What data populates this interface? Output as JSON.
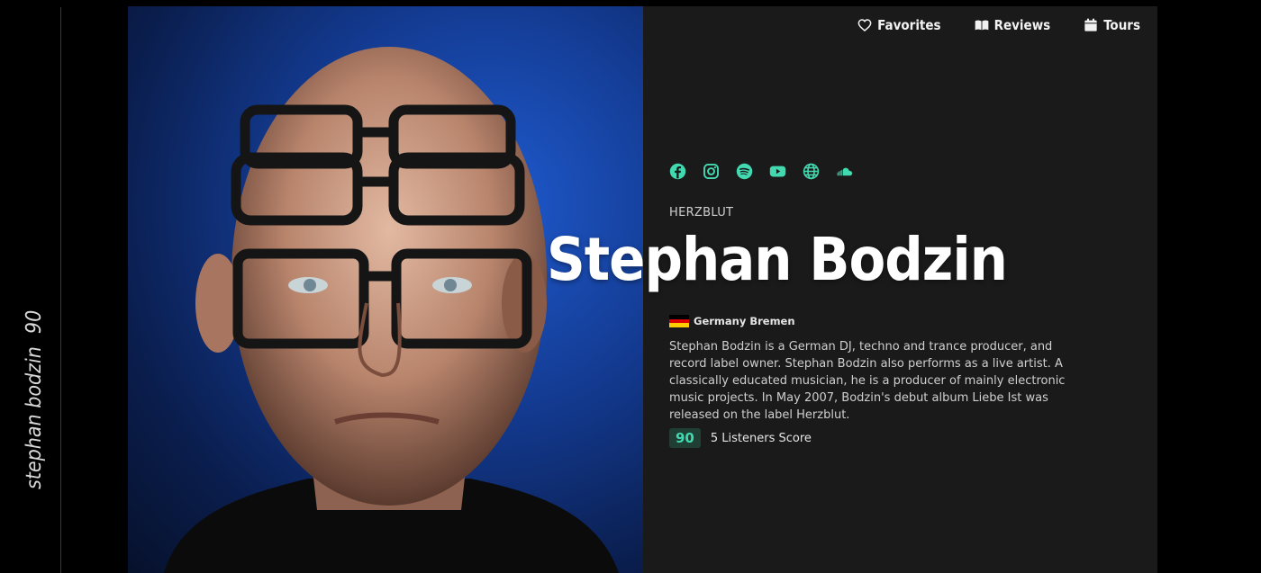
{
  "sidebar": {
    "title": "stephan bodzin",
    "score": "90"
  },
  "nav": {
    "favorites": "Favorites",
    "reviews": "Reviews",
    "tours": "Tours"
  },
  "socials": [
    "facebook-icon",
    "instagram-icon",
    "spotify-icon",
    "youtube-icon",
    "globe-icon",
    "soundcloud-icon"
  ],
  "artist": {
    "label": "HERZBLUT",
    "name": "Stephan Bodzin",
    "location": "Germany Bremen",
    "bio": "Stephan Bodzin is a German DJ, techno and trance producer, and record label owner. Stephan Bodzin also performs as a live artist. A classically educated musician, he is a producer of mainly electronic music projects. In May 2007, Bodzin's debut album Liebe Ist was released on the label Herzblut.",
    "score": "90",
    "score_text": "5 Listeners Score"
  },
  "colors": {
    "accent": "#43d9b0",
    "panel": "#1a1a1a",
    "background": "#000000",
    "flag": [
      "#000000",
      "#dd0000",
      "#ffce00"
    ]
  }
}
